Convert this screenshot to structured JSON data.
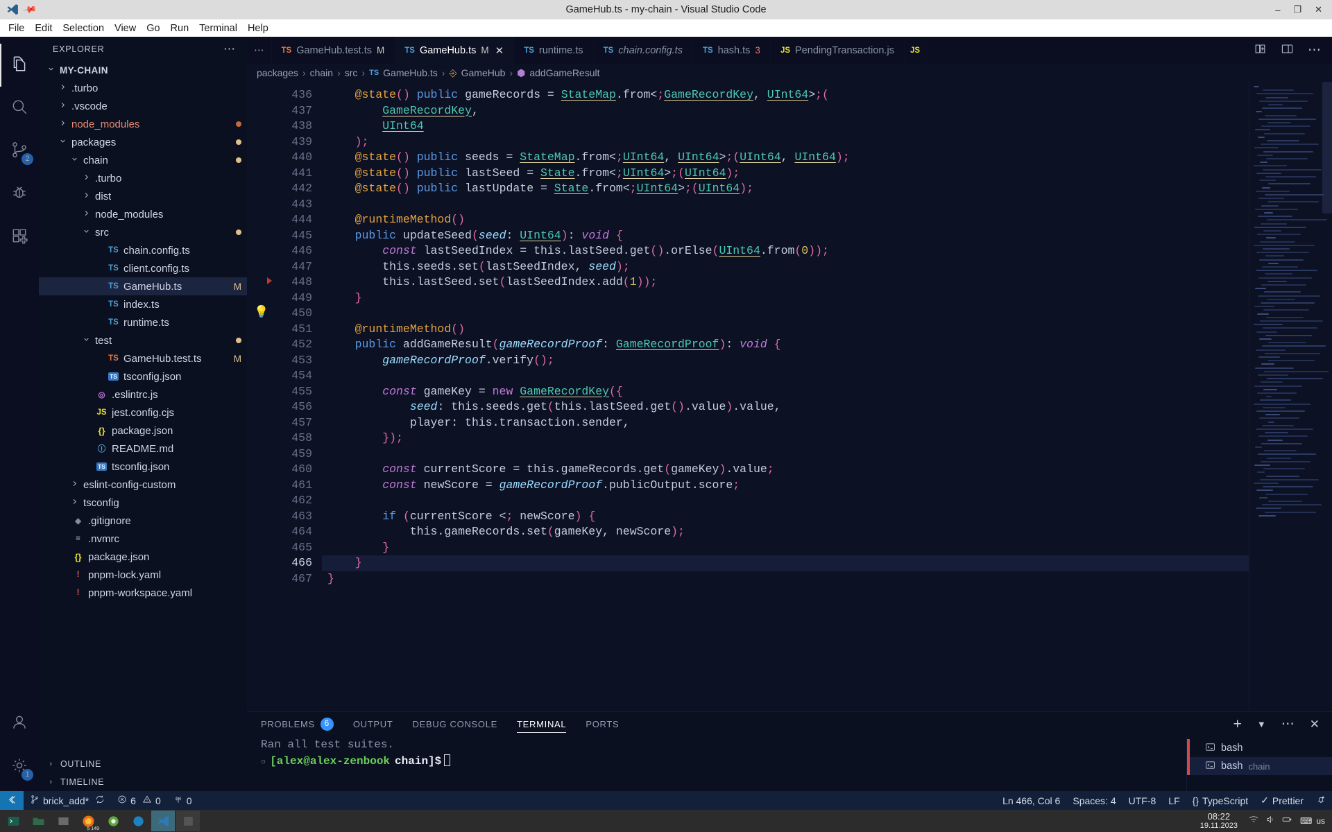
{
  "titlebar": {
    "title": "GameHub.ts - my-chain - Visual Studio Code",
    "window_controls": [
      "–",
      "❐",
      "✕"
    ]
  },
  "menubar": {
    "items": [
      "File",
      "Edit",
      "Selection",
      "View",
      "Go",
      "Run",
      "Terminal",
      "Help"
    ]
  },
  "activitybar": {
    "items": [
      {
        "name": "explorer",
        "icon": "files-icon",
        "badge": ""
      },
      {
        "name": "search",
        "icon": "search-icon",
        "badge": ""
      },
      {
        "name": "source-control",
        "icon": "source-control-icon",
        "badge": "2"
      },
      {
        "name": "run-and-debug",
        "icon": "debug-icon",
        "badge": ""
      },
      {
        "name": "extensions",
        "icon": "extensions-icon",
        "badge": ""
      }
    ],
    "bottom": [
      {
        "name": "accounts",
        "icon": "account-icon",
        "badge": ""
      },
      {
        "name": "manage",
        "icon": "gear-icon",
        "badge": "1"
      }
    ]
  },
  "sidebar": {
    "header": "EXPLORER",
    "more": "⋯",
    "root": "MY-CHAIN",
    "tree": [
      {
        "label": ".turbo",
        "indent": 1,
        "type": "folder",
        "state": "collapsed"
      },
      {
        "label": ".vscode",
        "indent": 1,
        "type": "folder",
        "state": "collapsed"
      },
      {
        "label": "node_modules",
        "indent": 1,
        "type": "folder",
        "state": "collapsed",
        "color": "nm",
        "status": "ignored"
      },
      {
        "label": "packages",
        "indent": 1,
        "type": "folder",
        "state": "expanded",
        "status": "dirty"
      },
      {
        "label": "chain",
        "indent": 2,
        "type": "folder",
        "state": "expanded",
        "status": "dirty"
      },
      {
        "label": ".turbo",
        "indent": 3,
        "type": "folder",
        "state": "collapsed"
      },
      {
        "label": "dist",
        "indent": 3,
        "type": "folder",
        "state": "collapsed"
      },
      {
        "label": "node_modules",
        "indent": 3,
        "type": "folder",
        "state": "collapsed"
      },
      {
        "label": "src",
        "indent": 3,
        "type": "folder",
        "state": "expanded",
        "status": "dirty"
      },
      {
        "label": "chain.config.ts",
        "indent": 4,
        "type": "file",
        "icon": "ts"
      },
      {
        "label": "client.config.ts",
        "indent": 4,
        "type": "file",
        "icon": "ts"
      },
      {
        "label": "GameHub.ts",
        "indent": 4,
        "type": "file",
        "icon": "ts",
        "selected": true,
        "badge": "M"
      },
      {
        "label": "index.ts",
        "indent": 4,
        "type": "file",
        "icon": "ts"
      },
      {
        "label": "runtime.ts",
        "indent": 4,
        "type": "file",
        "icon": "ts"
      },
      {
        "label": "test",
        "indent": 3,
        "type": "folder",
        "state": "expanded",
        "status": "dirty"
      },
      {
        "label": "GameHub.test.ts",
        "indent": 4,
        "type": "file",
        "icon": "ts-o",
        "badge": "M"
      },
      {
        "label": "tsconfig.json",
        "indent": 4,
        "type": "file",
        "icon": "tsjson"
      },
      {
        "label": ".eslintrc.js",
        "indent": 3,
        "type": "file",
        "icon": "eslint"
      },
      {
        "label": "jest.config.cjs",
        "indent": 3,
        "type": "file",
        "icon": "js"
      },
      {
        "label": "package.json",
        "indent": 3,
        "type": "file",
        "icon": "json"
      },
      {
        "label": "README.md",
        "indent": 3,
        "type": "file",
        "icon": "md"
      },
      {
        "label": "tsconfig.json",
        "indent": 3,
        "type": "file",
        "icon": "tsjson"
      },
      {
        "label": "eslint-config-custom",
        "indent": 2,
        "type": "folder",
        "state": "collapsed"
      },
      {
        "label": "tsconfig",
        "indent": 2,
        "type": "folder",
        "state": "collapsed"
      },
      {
        "label": ".gitignore",
        "indent": 1,
        "type": "file",
        "icon": "git"
      },
      {
        "label": ".nvmrc",
        "indent": 1,
        "type": "file",
        "icon": "plain"
      },
      {
        "label": "package.json",
        "indent": 1,
        "type": "file",
        "icon": "json"
      },
      {
        "label": "pnpm-lock.yaml",
        "indent": 1,
        "type": "file",
        "icon": "yaml"
      },
      {
        "label": "pnpm-workspace.yaml",
        "indent": 1,
        "type": "file",
        "icon": "yaml"
      }
    ],
    "footer": [
      {
        "label": "OUTLINE",
        "state": "collapsed"
      },
      {
        "label": "TIMELINE",
        "state": "collapsed"
      }
    ]
  },
  "tabs": {
    "overflow": "⋯",
    "items": [
      {
        "label": "GameHub.test.ts",
        "icon": "ts-o",
        "modified": "M",
        "active": false,
        "italic": false
      },
      {
        "label": "GameHub.ts",
        "icon": "ts",
        "modified": "M",
        "active": true,
        "italic": false,
        "close": "✕"
      },
      {
        "label": "runtime.ts",
        "icon": "ts",
        "active": false,
        "italic": false
      },
      {
        "label": "chain.config.ts",
        "icon": "ts",
        "active": false,
        "italic": true
      },
      {
        "label": "hash.ts",
        "icon": "ts",
        "errors": "3",
        "active": false,
        "italic": false
      },
      {
        "label": "PendingTransaction.js",
        "icon": "js",
        "active": false,
        "italic": false
      },
      {
        "label": "JS",
        "icon": "js",
        "active": false,
        "italic": false,
        "partial": true
      }
    ],
    "actions": [
      "split-editor-icon",
      "layout-icon",
      "more-actions-icon"
    ]
  },
  "breadcrumb": {
    "parts": [
      "packages",
      "chain",
      "src",
      "GameHub.ts",
      "GameHub",
      "addGameResult"
    ],
    "separator": "›"
  },
  "editor": {
    "first_line": 436,
    "current_line": 466,
    "lines": [
      {
        "n": 436,
        "t": "    @state() public gameRecords = StateMap.from<GameRecordKey, UInt64>("
      },
      {
        "n": 437,
        "t": "        GameRecordKey,"
      },
      {
        "n": 438,
        "t": "        UInt64"
      },
      {
        "n": 439,
        "t": "    );"
      },
      {
        "n": 440,
        "t": "    @state() public seeds = StateMap.from<UInt64, UInt64>(UInt64, UInt64);"
      },
      {
        "n": 441,
        "t": "    @state() public lastSeed = State.from<UInt64>(UInt64);"
      },
      {
        "n": 442,
        "t": "    @state() public lastUpdate = State.from<UInt64>(UInt64);"
      },
      {
        "n": 443,
        "t": ""
      },
      {
        "n": 444,
        "t": "    @runtimeMethod()"
      },
      {
        "n": 445,
        "t": "    public updateSeed(seed: UInt64): void {"
      },
      {
        "n": 446,
        "t": "        const lastSeedIndex = this.lastSeed.get().orElse(UInt64.from(0));"
      },
      {
        "n": 447,
        "t": "        this.seeds.set(lastSeedIndex, seed);"
      },
      {
        "n": 448,
        "t": "        this.lastSeed.set(lastSeedIndex.add(1));"
      },
      {
        "n": 449,
        "t": "    }"
      },
      {
        "n": 450,
        "t": ""
      },
      {
        "n": 451,
        "t": "    @runtimeMethod()"
      },
      {
        "n": 452,
        "t": "    public addGameResult(gameRecordProof: GameRecordProof): void {"
      },
      {
        "n": 453,
        "t": "        gameRecordProof.verify();"
      },
      {
        "n": 454,
        "t": ""
      },
      {
        "n": 455,
        "t": "        const gameKey = new GameRecordKey({"
      },
      {
        "n": 456,
        "t": "            seed: this.seeds.get(this.lastSeed.get().value).value,"
      },
      {
        "n": 457,
        "t": "            player: this.transaction.sender,"
      },
      {
        "n": 458,
        "t": "        });"
      },
      {
        "n": 459,
        "t": ""
      },
      {
        "n": 460,
        "t": "        const currentScore = this.gameRecords.get(gameKey).value;"
      },
      {
        "n": 461,
        "t": "        const newScore = gameRecordProof.publicOutput.score;"
      },
      {
        "n": 462,
        "t": ""
      },
      {
        "n": 463,
        "t": "        if (currentScore < newScore) {"
      },
      {
        "n": 464,
        "t": "            this.gameRecords.set(gameKey, newScore);"
      },
      {
        "n": 465,
        "t": "        }"
      },
      {
        "n": 466,
        "t": "    }"
      },
      {
        "n": 467,
        "t": "}"
      }
    ],
    "lightbulb": "💡"
  },
  "panel": {
    "tabs": [
      {
        "label": "PROBLEMS",
        "badge": "6",
        "active": false
      },
      {
        "label": "OUTPUT",
        "active": false
      },
      {
        "label": "DEBUG CONSOLE",
        "active": false
      },
      {
        "label": "TERMINAL",
        "active": true
      },
      {
        "label": "PORTS",
        "active": false
      }
    ],
    "actions": [
      "add-terminal-icon",
      "split-terminal-chevron-icon",
      "more-actions-icon",
      "close-panel-icon"
    ],
    "terminal": {
      "output": "Ran all test suites.",
      "prompt_user": "[alex@alex-zenbook",
      "prompt_dir": "chain]$",
      "bullet": "○"
    },
    "terminal_list": [
      {
        "label": "bash",
        "sub": "",
        "active": false
      },
      {
        "label": "bash",
        "sub": "chain",
        "active": true
      }
    ]
  },
  "statusbar": {
    "remote": "remote-icon",
    "branch": "brick_add*",
    "sync": "sync-icon",
    "errors": "6",
    "warnings": "0",
    "ports": "0",
    "cursor": "Ln 466, Col 6",
    "spaces": "Spaces: 4",
    "encoding": "UTF-8",
    "eol": "LF",
    "language": "TypeScript",
    "formatter": "Prettier",
    "bell": "bell-icon"
  },
  "taskbar": {
    "clock_time": "08:22",
    "clock_date": "19.11.2023",
    "lang": "us",
    "firefox_badge": "5 149"
  },
  "colors": {
    "accent": "#3794ff",
    "modified": "#e2c08d",
    "error": "#f07070",
    "bg": "#0c1124",
    "sidebar_bg": "#0b1021",
    "status_bg": "#13203a",
    "remote_bg": "#1574b3"
  }
}
